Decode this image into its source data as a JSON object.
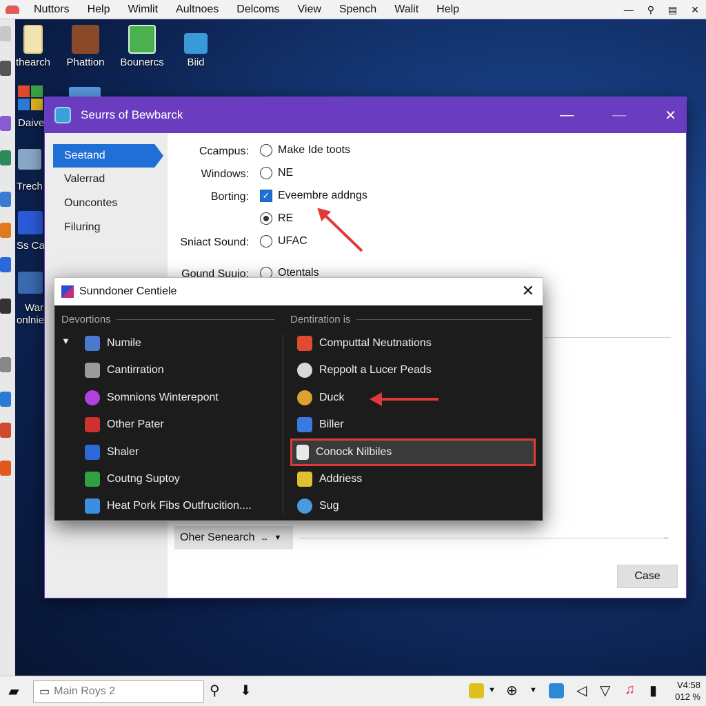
{
  "menubar": {
    "items": [
      "Nuttors",
      "Help",
      "Wimlit",
      "Aultnoes",
      "Delcoms",
      "View",
      "Spench",
      "Walit",
      "Help"
    ],
    "tray_icons": [
      "minimize-icon",
      "search-icon",
      "clipboard-icon",
      "close-icon"
    ]
  },
  "desktop": {
    "icons": [
      {
        "label": "thearch",
        "icon": "folder-icon"
      },
      {
        "label": "Phattion",
        "icon": "photo-icon"
      },
      {
        "label": "Bounercs",
        "icon": "spreadsheet-icon"
      },
      {
        "label": "Biid",
        "icon": "image-icon"
      }
    ],
    "side_labels": [
      "Daive",
      "Trech",
      "Ss Cai",
      "War",
      "onlnie"
    ]
  },
  "main_window": {
    "title": "Seurrs of Bewbarck",
    "controls": [
      "minimize-icon",
      "maximize-icon",
      "close-icon"
    ],
    "sidebar": [
      "Seetand",
      "Valerrad",
      "Ouncontes",
      "Filuring"
    ],
    "active_sidebar_index": 0,
    "form": {
      "rows": [
        {
          "label": "Ccampus:",
          "option": "Make Ide toots",
          "control": "radio",
          "checked": false
        },
        {
          "label": "Windows:",
          "option": "NE",
          "control": "radio",
          "checked": false
        },
        {
          "label": "Borting:",
          "option": "Eveembre addngs",
          "control": "checkbox",
          "checked": true
        },
        {
          "label": "",
          "option": "RE",
          "control": "radio",
          "checked": true
        },
        {
          "label": "Sniact Sound:",
          "option": "UFAC",
          "control": "radio",
          "checked": false
        },
        {
          "label": "Gound Suuio:",
          "option": "Otentals",
          "control": "radio",
          "checked": false
        }
      ]
    },
    "search_combo": "Oher Senearch",
    "close_button": "Case"
  },
  "dialog": {
    "title": "Sunndoner Centiele",
    "left_group": "Devortions",
    "right_group": "Dentiration is",
    "left_items": [
      {
        "label": "Numile",
        "icon": "user-icon",
        "color": "#4a7ad0"
      },
      {
        "label": "Cantirration",
        "icon": "tools-icon",
        "color": "#b0b0b0"
      },
      {
        "label": "Somnions Winterepont",
        "icon": "star-icon",
        "color": "#b040e0"
      },
      {
        "label": "Other Pater",
        "icon": "mail-icon",
        "color": "#d03030"
      },
      {
        "label": "Shaler",
        "icon": "share-icon",
        "color": "#2a6ad8"
      },
      {
        "label": "Coutng Suptoy",
        "icon": "grid-icon",
        "color": "#30a040"
      },
      {
        "label": "Heat Pork Fibs Outfrucition....",
        "icon": "app-icon",
        "color": "#3a90e0"
      }
    ],
    "right_items": [
      {
        "label": "Computtal Neutnations",
        "icon": "document-icon",
        "color": "#e04a30"
      },
      {
        "label": "Reppolt a Lucer Peads",
        "icon": "chrome-icon",
        "color": "#d8d8d8"
      },
      {
        "label": "Duck",
        "icon": "globe-icon",
        "color": "#e0a030"
      },
      {
        "label": "Biller",
        "icon": "burst-icon",
        "color": "#3a7ae0"
      },
      {
        "label": "Conock Nilbiles",
        "icon": "lock-icon",
        "color": "#e8e8e8"
      },
      {
        "label": "Addriess",
        "icon": "pen-icon",
        "color": "#e0c030"
      },
      {
        "label": "Sug",
        "icon": "spark-icon",
        "color": "#4a9ae0"
      }
    ],
    "selected_right_index": 4
  },
  "taskbar": {
    "search_text": "Main Roys 2",
    "clock_time": "V4:58",
    "clock_date": "012 % "
  },
  "colors": {
    "title_purple": "#6a3cc0",
    "accent_blue": "#1f6fd6",
    "annotation_red": "#e0393b"
  }
}
